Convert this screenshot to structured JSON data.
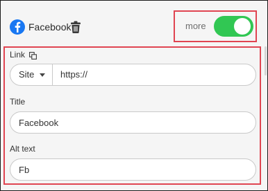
{
  "header": {
    "network_name": "Facebook",
    "logo_icon": "facebook-logo-icon",
    "delete_icon": "trash-icon",
    "brand_color": "#1877f2"
  },
  "toggle": {
    "label": "more",
    "state": "on",
    "color": "#31c753"
  },
  "form": {
    "link": {
      "label": "Link",
      "copy_icon": "copy-icon",
      "source_select": "Site",
      "url_value": "https://"
    },
    "title": {
      "label": "Title",
      "value": "Facebook"
    },
    "alt_text": {
      "label": "Alt text",
      "value": "Fb"
    }
  },
  "highlight_color": "#e04451"
}
